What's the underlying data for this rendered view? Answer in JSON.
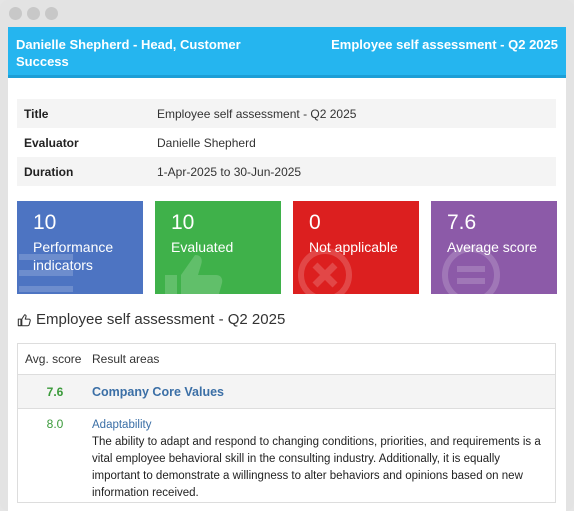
{
  "window": {
    "controls": [
      "close",
      "minimize",
      "maximize"
    ]
  },
  "header": {
    "left": "Danielle Shepherd - Head, Customer Success",
    "right": "Employee self assessment - Q2 2025"
  },
  "info": [
    {
      "label": "Title",
      "value": "Employee self assessment - Q2 2025"
    },
    {
      "label": "Evaluator",
      "value": "Danielle Shepherd"
    },
    {
      "label": "Duration",
      "value": "1-Apr-2025 to 30-Jun-2025"
    }
  ],
  "tiles": [
    {
      "value": "10",
      "label": "Performance indicators",
      "color": "#4d74c2",
      "icon": "list-icon"
    },
    {
      "value": "10",
      "label": "Evaluated",
      "color": "#3fb14a",
      "icon": "thumbs-up-icon"
    },
    {
      "value": "0",
      "label": "Not applicable",
      "color": "#dc1f1f",
      "icon": "x-circle-icon"
    },
    {
      "value": "7.6",
      "label": "Average score",
      "color": "#8c5aa8",
      "icon": "equal-circle-icon"
    }
  ],
  "section": {
    "title": "Employee self assessment - Q2 2025",
    "icon": "thumbs-up-icon"
  },
  "table": {
    "headers": [
      "Avg. score",
      "Result areas"
    ],
    "group": {
      "score": "7.6",
      "name": "Company Core Values"
    },
    "items": [
      {
        "score": "8.0",
        "name": "Adaptability",
        "description": "The ability to adapt and respond to changing conditions, priorities, and requirements is a vital employee behavioral skill in the consulting industry. Additionally, it is equally important to demonstrate a willingness to alter behaviors and opinions based on new information received."
      }
    ]
  },
  "colors": {
    "header": "#25b5ef",
    "score_green": "#3a9a3a",
    "link_blue": "#3b6fa6"
  }
}
